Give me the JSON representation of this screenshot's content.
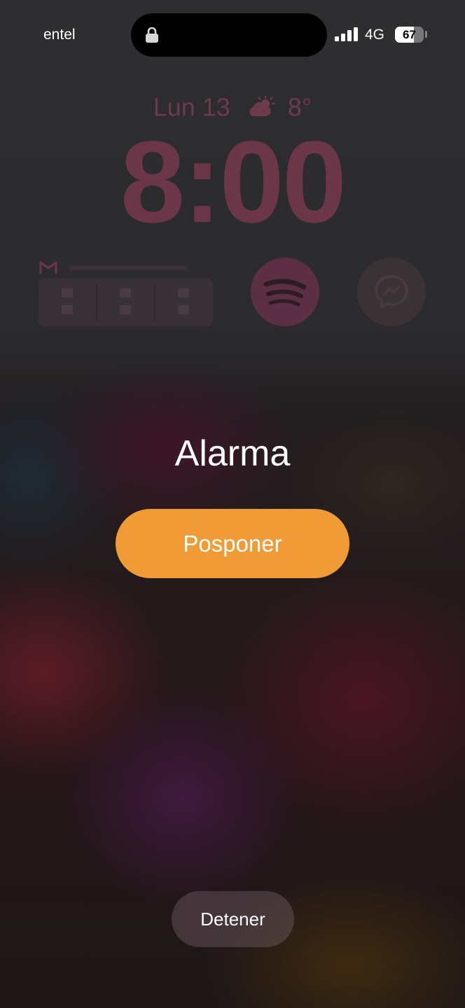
{
  "status_bar": {
    "carrier": "entel",
    "network": "4G",
    "battery_percent": 67,
    "battery_label": "67",
    "signal_bars": 4,
    "icons": [
      "lock-icon",
      "signal-icon",
      "battery-icon"
    ]
  },
  "lock_screen": {
    "date": "Lun 13",
    "temperature": "8°",
    "weather_icon": "partly-cloudy-icon",
    "time": "8:00",
    "widgets": [
      "gmail-widget",
      "spotify-icon",
      "messenger-icon"
    ]
  },
  "alarm": {
    "title": "Alarma",
    "snooze_label": "Posponer",
    "stop_label": "Detener"
  },
  "colors": {
    "snooze_button": "#f09b35",
    "clock_tint": "#6a3648"
  }
}
